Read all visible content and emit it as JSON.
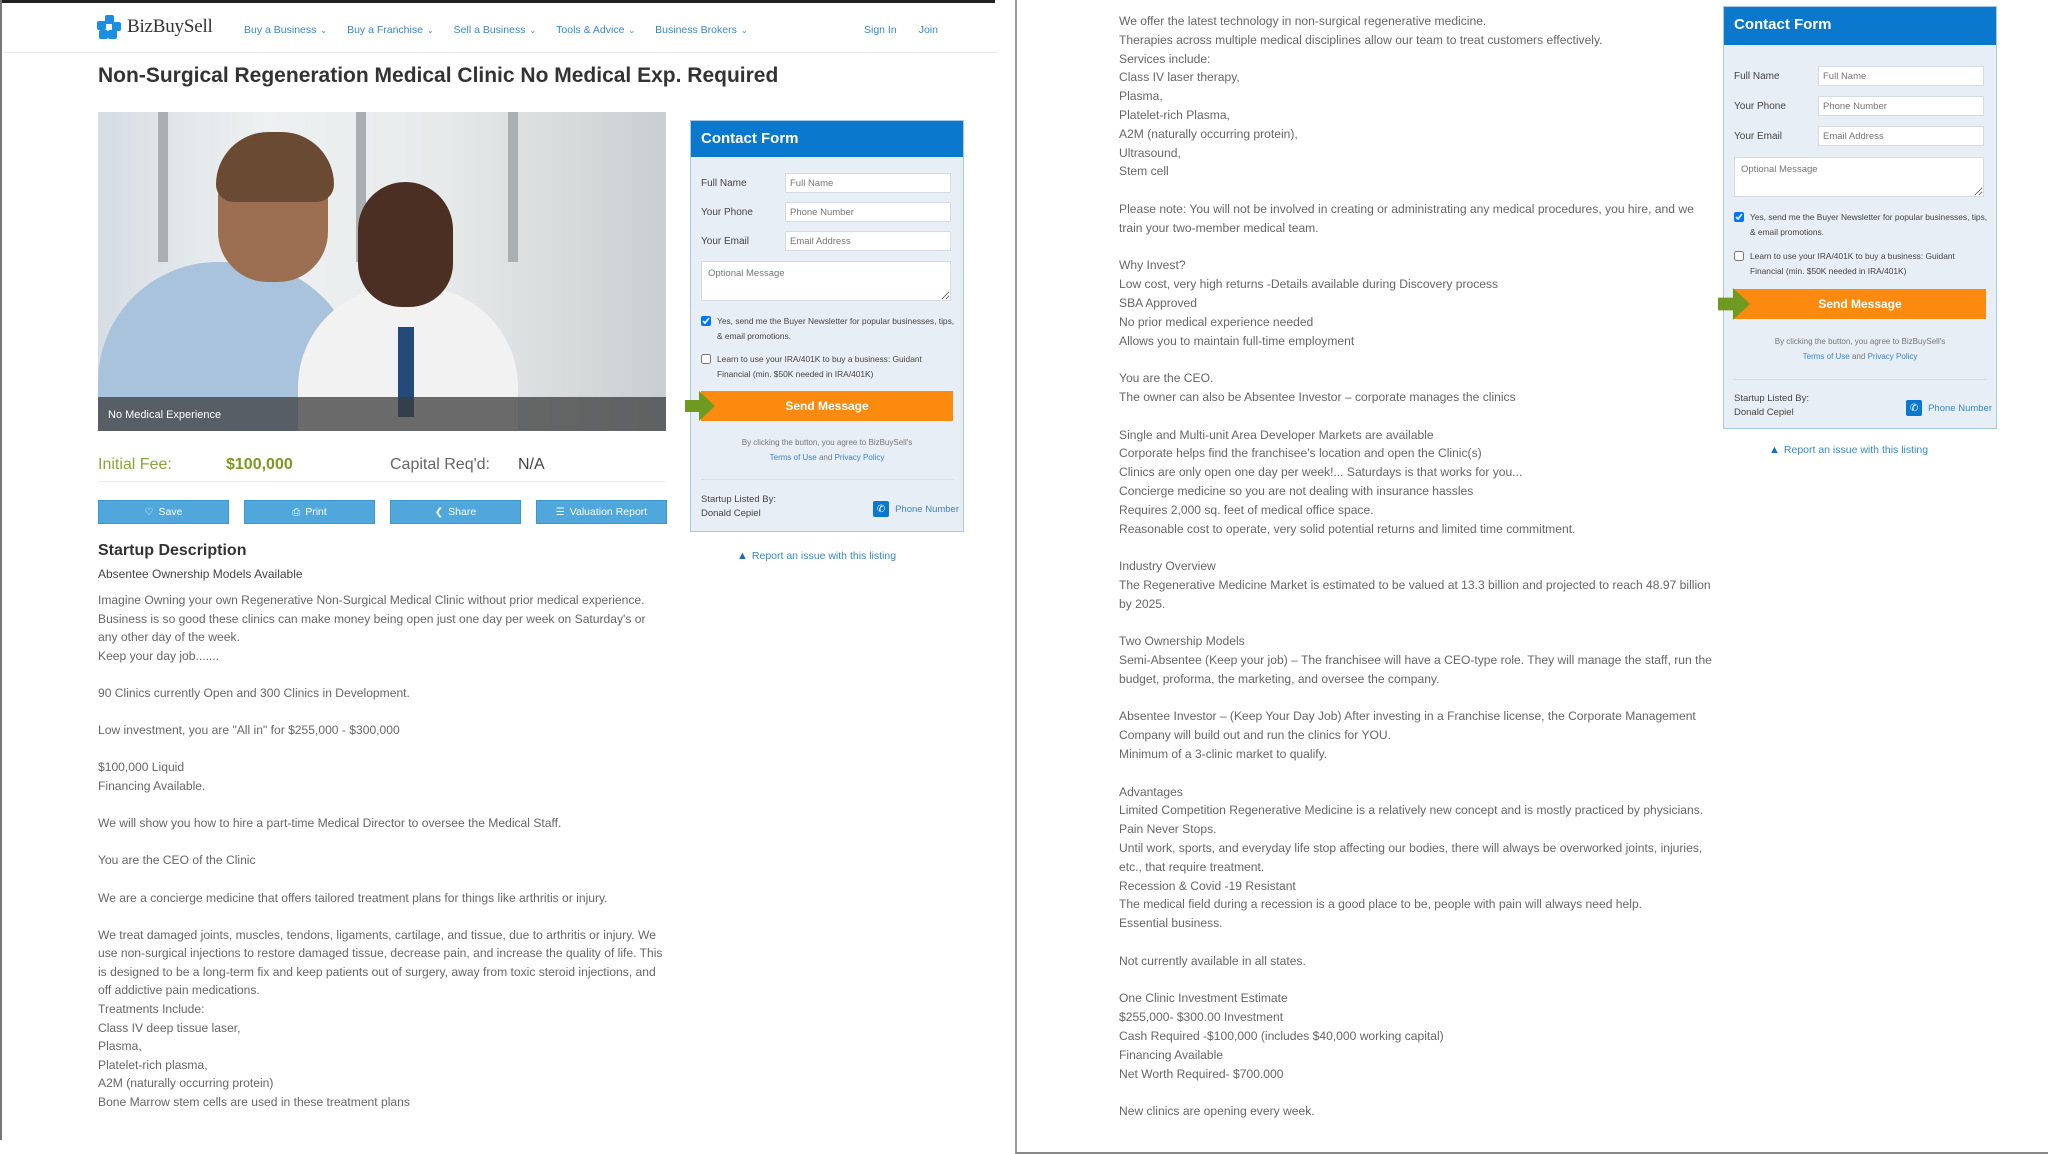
{
  "nav": {
    "brand": "BizBuySell",
    "links": [
      "Buy a Business",
      "Buy a Franchise",
      "Sell a Business",
      "Tools & Advice",
      "Business Brokers"
    ],
    "sign_in": "Sign In",
    "join": "Join"
  },
  "listing": {
    "title": "Non-Surgical Regeneration Medical Clinic No Medical Exp. Required",
    "photo_caption": "No Medical Experience",
    "initial_fee_label": "Initial Fee:",
    "initial_fee_value": "$100,000",
    "capital_label": "Capital Req'd:",
    "capital_value": "N/A",
    "buttons": {
      "save": "Save",
      "print": "Print",
      "share": "Share",
      "valuation": "Valuation Report"
    },
    "description_title": "Startup Description",
    "description_subtitle": "Absentee Ownership Models Available",
    "description_left": [
      "Imagine Owning your own Regenerative Non-Surgical Medical Clinic without prior medical experience.",
      "Business is so good these clinics can make money being open just one day per week on Saturday's or any other day of the week.",
      "Keep your day job.......",
      "",
      "90 Clinics currently Open and 300 Clinics in Development.",
      "",
      "Low investment, you are \"All in\" for $255,000 - $300,000",
      "",
      "$100,000 Liquid",
      "Financing Available.",
      "",
      "We will show you how to hire a part-time Medical Director to oversee the Medical Staff.",
      "",
      "You are the CEO of the Clinic",
      "",
      "We are a concierge medicine that offers tailored treatment plans for things like arthritis or injury.",
      "",
      "We treat damaged joints, muscles, tendons, ligaments, cartilage, and tissue, due to arthritis or injury. We use non-surgical injections to restore damaged tissue, decrease pain, and increase the quality of life. This is designed to be a long-term fix and keep patients out of surgery, away from toxic steroid injections, and off addictive pain medications.",
      "Treatments Include:",
      "Class IV deep tissue laser,",
      "Plasma,",
      "Platelet-rich plasma,",
      "A2M (naturally occurring protein)",
      "Bone Marrow stem cells are used in these treatment plans"
    ],
    "description_right": [
      "We offer the latest technology in non-surgical regenerative medicine.",
      "Therapies across multiple medical disciplines allow our team to treat customers effectively.",
      "Services include:",
      "Class IV laser therapy,",
      "Plasma,",
      "Platelet-rich Plasma,",
      "A2M (naturally occurring protein),",
      "Ultrasound,",
      "Stem cell",
      "",
      "Please note: You will not be involved in creating or administrating any medical procedures, you hire, and we train your two-member medical team.",
      "",
      "Why Invest?",
      "Low cost, very high returns -Details available during Discovery process",
      "SBA Approved",
      "No prior medical experience needed",
      "Allows you to maintain full-time employment",
      "",
      "You are the CEO.",
      "The owner can also be Absentee Investor – corporate manages the clinics",
      "",
      "Single and Multi-unit Area Developer Markets are available",
      "Corporate helps find the franchisee's location and open the Clinic(s)",
      "Clinics are only open one day per week!... Saturdays is that works for you...",
      "Concierge medicine so you are not dealing with insurance hassles",
      "Requires 2,000 sq. feet of medical office space.",
      "Reasonable cost to operate, very solid potential returns and limited time commitment.",
      "",
      "Industry Overview",
      "The Regenerative Medicine Market is estimated to be valued at 13.3 billion and projected to reach 48.97 billion by 2025.",
      "",
      "Two Ownership Models",
      "Semi-Absentee (Keep your job) – The franchisee will have a CEO-type role. They will manage the staff, run the budget, proforma, the marketing, and oversee the company.",
      "",
      "Absentee Investor – (Keep Your Day Job) After investing in a Franchise license, the Corporate Management Company will build out and run the clinics for YOU.",
      "Minimum of a 3-clinic market to qualify.",
      "",
      "Advantages",
      "Limited Competition Regenerative Medicine is a relatively new concept and is mostly practiced by physicians.",
      "Pain Never Stops.",
      "Until work, sports, and everyday life stop affecting our bodies, there will always be overworked joints, injuries, etc., that require treatment.",
      "Recession & Covid -19 Resistant",
      "The medical field during a recession is a good place to be, people with pain will always need help.",
      "Essential business.",
      "",
      "Not currently available in all states.",
      "",
      "One Clinic Investment Estimate",
      "$255,000- $300.00 Investment",
      "Cash Required -$100,000 (includes $40,000 working capital)",
      "Financing Available",
      "Net Worth Required- $700.000",
      "",
      "New clinics are opening every week."
    ]
  },
  "contact_form": {
    "title": "Contact Form",
    "full_name_label": "Full Name",
    "full_name_placeholder": "Full Name",
    "phone_label": "Your Phone",
    "phone_placeholder": "Phone Number",
    "email_label": "Your Email",
    "email_placeholder": "Email Address",
    "message_placeholder": "Optional Message",
    "newsletter_label": "Yes, send me the Buyer Newsletter for popular businesses, tips, & email promotions.",
    "newsletter_checked": true,
    "ira_label": "Learn to use your IRA/401K to buy a business: Guidant Financial (min. $50K needed in IRA/401K)",
    "ira_checked": false,
    "send_label": "Send Message",
    "agree_text": "By clicking the button, you agree to BizBuySell's",
    "terms_label": "Terms of Use",
    "and_text": "and",
    "privacy_label": "Privacy Policy",
    "listed_by_label": "Startup Listed By:",
    "listed_by_name": "Donald Cepiel",
    "phone_link": "Phone Number",
    "report_link": "Report an issue with this listing"
  },
  "colors": {
    "brand_blue": "#0a78cc",
    "button_blue": "#4fa7dc",
    "send_orange": "#fb8a0f",
    "fee_green": "#7a9a1e",
    "link_blue": "#3a86c8"
  }
}
